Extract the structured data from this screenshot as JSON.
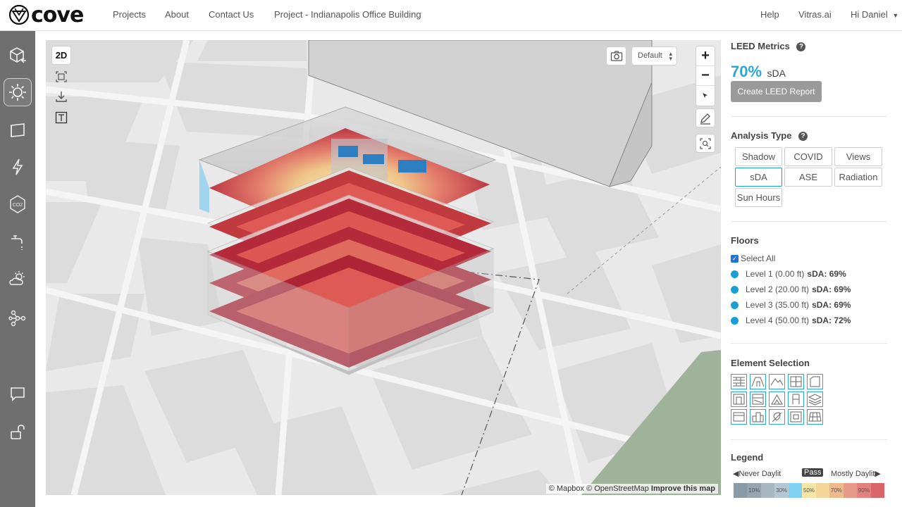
{
  "app": {
    "logo_text": "cove"
  },
  "nav": {
    "projects": "Projects",
    "about": "About",
    "contact": "Contact Us",
    "project": "Project - Indianapolis Office Building",
    "help": "Help",
    "vitras": "Vitras.ai",
    "user": "Hi Daniel"
  },
  "sidebar": {
    "items": [
      "3d-box-icon",
      "sun-icon",
      "panel-icon",
      "lightning-icon",
      "co2-icon",
      "faucet-icon",
      "cloud-sun-icon",
      "network-icon",
      "chat-icon",
      "unlock-icon"
    ],
    "active": "sun-icon"
  },
  "map": {
    "btn_2d": "2D",
    "view_select": "Default",
    "zoom_in": "+",
    "zoom_out": "−",
    "attribution_a": "© Mapbox © OpenStreetMap",
    "attribution_b": "Improve this map"
  },
  "panel": {
    "leed": {
      "title": "LEED Metrics",
      "help": "?",
      "value": "70%",
      "unit": "sDA",
      "button": "Create LEED Report"
    },
    "analysis": {
      "title": "Analysis Type",
      "help": "?",
      "types": [
        "Shadow",
        "COVID",
        "Views",
        "sDA",
        "ASE",
        "Radiation",
        "Sun Hours"
      ],
      "active": "sDA"
    },
    "floors": {
      "title": "Floors",
      "select_all": "Select All",
      "levels": [
        {
          "name": "Level 1 (0.00 ft)",
          "metric": "sDA: 69%"
        },
        {
          "name": "Level 2 (20.00 ft)",
          "metric": "sDA: 69%"
        },
        {
          "name": "Level 3 (35.00 ft)",
          "metric": "sDA: 69%"
        },
        {
          "name": "Level 4 (50.00 ft)",
          "metric": "sDA: 72%"
        }
      ]
    },
    "elements": {
      "title": "Element Selection"
    },
    "legend": {
      "title": "Legend",
      "left": "◀Never Daylit",
      "pass": "Pass",
      "right": "Mostly Daylit▶",
      "steps": [
        "",
        "10%",
        "",
        "30%",
        "",
        "50%",
        "",
        "70%",
        "",
        "90%",
        ""
      ],
      "colors": [
        "#8a9aa6",
        "#97a5b1",
        "#a8b6c1",
        "#b5c7d3",
        "#7fd2f3",
        "#f6e7a8",
        "#f3d79a",
        "#eeb98c",
        "#e89b8a",
        "#e3827d",
        "#d9656a"
      ]
    }
  },
  "colors": {
    "accent": "#1b9fd3",
    "sidebar": "#6f6f6f"
  }
}
